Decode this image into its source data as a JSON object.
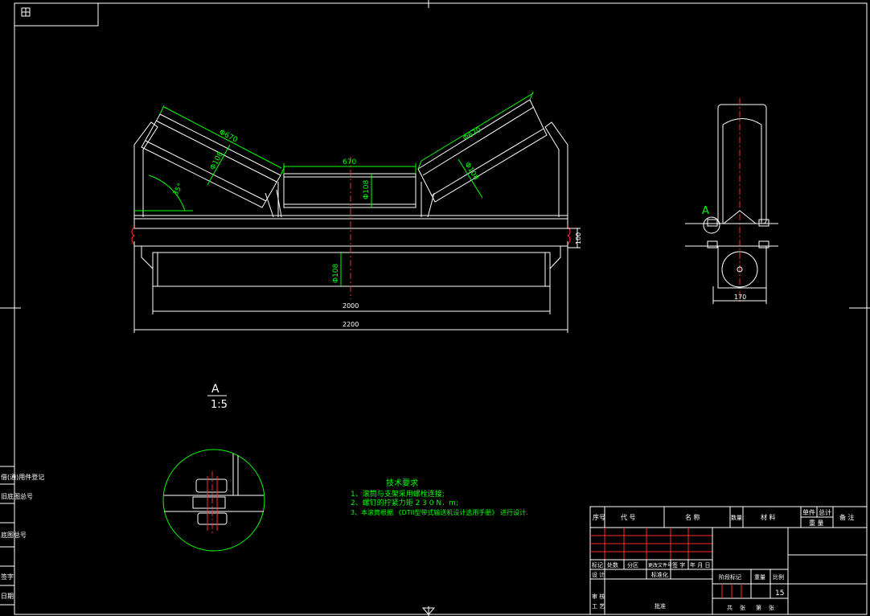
{
  "drawing": {
    "dimensions": {
      "roller_side_diameter_left": "Φ670",
      "roller_side_bore_left": "Φ108",
      "angle": "35°",
      "center_roller_length": "670",
      "center_roller_diameter": "Φ108",
      "roller_side_diameter_right": "Φ670",
      "roller_side_bore_right": "Φ108",
      "return_roller_diameter": "Φ108",
      "return_length": "2000",
      "overall_length": "2200",
      "side_height": "100",
      "side_width": "170"
    },
    "detail_label": "A",
    "detail_marker": "A",
    "detail_scale": "1:5"
  },
  "tech_requirements": {
    "title": "技术要求",
    "items": [
      "1、滚筒与支架采用螺栓连接;",
      "2、螺钉的拧紧力矩 2 3 0 N．m;",
      "3、本滚筒根据 《DTII型带式输送机设计选用手册》 进行设计."
    ]
  },
  "title_block": {
    "headers": [
      "序号",
      "代  号",
      "名  称",
      "数量",
      "材  料",
      "单件",
      "总计",
      "备  注"
    ],
    "weight": "重 量",
    "row1": [
      "标记",
      "处数",
      "分区",
      "更改文件号",
      "签 字",
      "年 月 日"
    ],
    "rows": [
      "设 计",
      "标准化",
      "审 核",
      "工 艺",
      "批准"
    ],
    "stage": [
      "阶段标记",
      "重量",
      "比例"
    ],
    "scale": "15",
    "sheet": [
      "共",
      "张",
      "第",
      "张"
    ]
  },
  "margin_labels": [
    "借(通)用件登记",
    "旧底图总号",
    "底图总号",
    "签字",
    "日期"
  ]
}
